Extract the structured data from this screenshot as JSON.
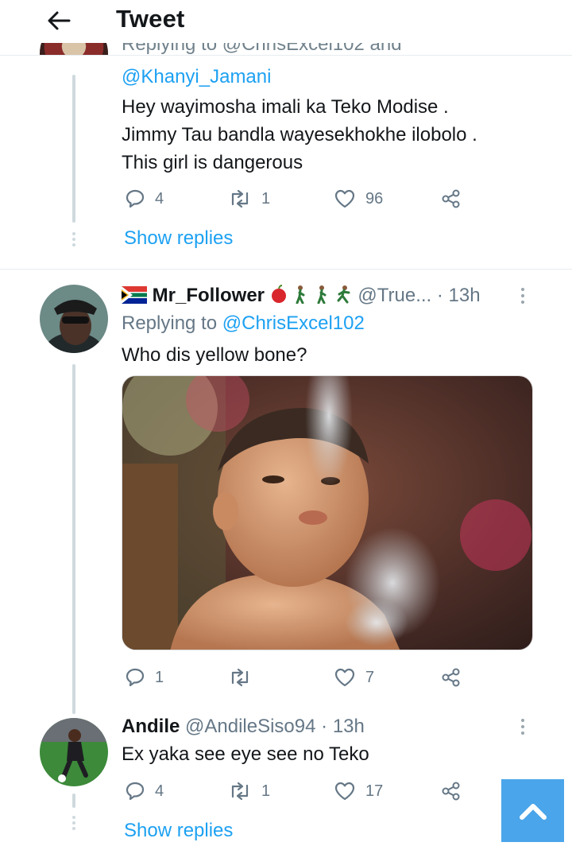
{
  "header": {
    "title": "Tweet"
  },
  "prev_tweet": {
    "reply_cutoff": "Replying to @ChrisExcel102 and",
    "mention": "@Khanyi_Jamani",
    "text_lines": [
      "Hey wayimosha imali ka Teko Modise .",
      "Jimmy Tau bandla wayesekhokhe ilobolo .",
      "This girl is dangerous"
    ],
    "replies": "4",
    "retweets": "1",
    "likes": "96",
    "show_replies": "Show replies"
  },
  "tweet2": {
    "name": "Mr_Follower",
    "handle": "@True...",
    "time": "· 13h",
    "replying_label": "Replying to",
    "replying_to": "@ChrisExcel102",
    "text": "Who dis yellow bone?",
    "replies": "1",
    "retweets": "",
    "likes": "7"
  },
  "tweet3": {
    "name": "Andile",
    "handle": "@AndileSiso94",
    "time": "· 13h",
    "text": "Ex yaka see eye see no Teko",
    "replies": "4",
    "retweets": "1",
    "likes": "17",
    "show_replies": "Show replies"
  },
  "colors": {
    "link": "#1da1f2",
    "muted": "#657786",
    "scroll_button": "#4aa5ea"
  },
  "icons": [
    "back-arrow-icon",
    "reply-icon",
    "retweet-icon",
    "like-icon",
    "share-icon",
    "more-icon",
    "chevron-up-icon"
  ]
}
